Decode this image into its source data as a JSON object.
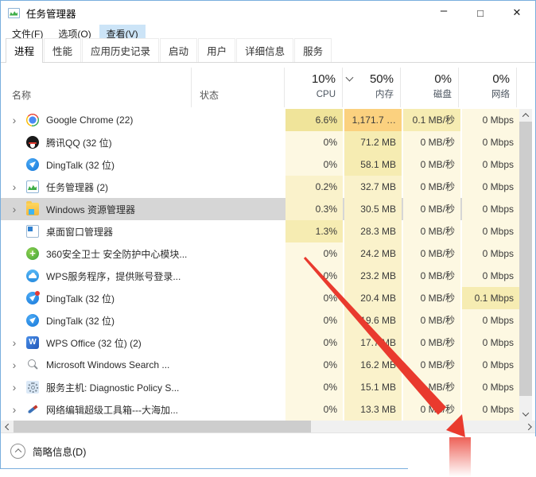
{
  "window": {
    "title": "任务管理器",
    "controls": {
      "minimize": "–",
      "maximize": "□",
      "close": "✕"
    }
  },
  "menu": [
    {
      "label": "文件(F)"
    },
    {
      "label": "选项(O)"
    },
    {
      "label": "查看(V)",
      "highlighted": true
    }
  ],
  "tabs": [
    {
      "label": "进程",
      "active": true
    },
    {
      "label": "性能"
    },
    {
      "label": "应用历史记录"
    },
    {
      "label": "启动"
    },
    {
      "label": "用户"
    },
    {
      "label": "详细信息"
    },
    {
      "label": "服务"
    }
  ],
  "columns": {
    "name": "名称",
    "status": "状态",
    "metrics": [
      {
        "percent": "10%",
        "label": "CPU"
      },
      {
        "percent": "50%",
        "label": "内存",
        "sorted": "desc"
      },
      {
        "percent": "0%",
        "label": "磁盘"
      },
      {
        "percent": "0%",
        "label": "网络"
      }
    ]
  },
  "glyphs": {
    "expand": "›"
  },
  "colors": {
    "accent_border": "#79aede",
    "menu_highlight": "#cce4f7",
    "selected_row": "#d6d6d6",
    "heat": [
      "#fdf8e2",
      "#faf2cb",
      "#f6ecb2",
      "#f0e49a",
      "#fbd17f"
    ],
    "annotation_arrow": "#e93a2e"
  },
  "processes": [
    {
      "name": "Google Chrome (22)",
      "icon": "chrome",
      "expandable": true,
      "selected": false,
      "badge": false,
      "cpu": "6.6%",
      "mem": "1,171.7 …",
      "disk": "0.1 MB/秒",
      "net": "0 Mbps",
      "heat": [
        3,
        4,
        2,
        0
      ]
    },
    {
      "name": "腾讯QQ (32 位)",
      "icon": "qq",
      "expandable": false,
      "selected": false,
      "badge": false,
      "cpu": "0%",
      "mem": "71.2 MB",
      "disk": "0 MB/秒",
      "net": "0 Mbps",
      "heat": [
        0,
        2,
        0,
        0
      ]
    },
    {
      "name": "DingTalk (32 位)",
      "icon": "dingtalk",
      "expandable": false,
      "selected": false,
      "badge": false,
      "cpu": "0%",
      "mem": "58.1 MB",
      "disk": "0 MB/秒",
      "net": "0 Mbps",
      "heat": [
        0,
        2,
        0,
        0
      ]
    },
    {
      "name": "任务管理器 (2)",
      "icon": "taskmgr",
      "expandable": true,
      "selected": false,
      "badge": false,
      "cpu": "0.2%",
      "mem": "32.7 MB",
      "disk": "0 MB/秒",
      "net": "0 Mbps",
      "heat": [
        1,
        1,
        0,
        0
      ]
    },
    {
      "name": "Windows 资源管理器",
      "icon": "explorer",
      "expandable": true,
      "selected": true,
      "badge": false,
      "cpu": "0.3%",
      "mem": "30.5 MB",
      "disk": "0 MB/秒",
      "net": "0 Mbps",
      "heat": [
        1,
        1,
        0,
        0
      ]
    },
    {
      "name": "桌面窗口管理器",
      "icon": "dwm",
      "expandable": false,
      "selected": false,
      "badge": false,
      "cpu": "1.3%",
      "mem": "28.3 MB",
      "disk": "0 MB/秒",
      "net": "0 Mbps",
      "heat": [
        2,
        1,
        0,
        0
      ]
    },
    {
      "name": "360安全卫士 安全防护中心模块...",
      "icon": "safe360",
      "expandable": false,
      "selected": false,
      "badge": false,
      "cpu": "0%",
      "mem": "24.2 MB",
      "disk": "0 MB/秒",
      "net": "0 Mbps",
      "heat": [
        0,
        1,
        0,
        0
      ]
    },
    {
      "name": "WPS服务程序，提供账号登录...",
      "icon": "wpscloud",
      "expandable": false,
      "selected": false,
      "badge": false,
      "cpu": "0%",
      "mem": "23.2 MB",
      "disk": "0 MB/秒",
      "net": "0 Mbps",
      "heat": [
        0,
        1,
        0,
        0
      ]
    },
    {
      "name": "DingTalk (32 位)",
      "icon": "dingtalk",
      "expandable": false,
      "selected": false,
      "badge": true,
      "cpu": "0%",
      "mem": "20.4 MB",
      "disk": "0 MB/秒",
      "net": "0.1 Mbps",
      "heat": [
        0,
        1,
        0,
        2
      ]
    },
    {
      "name": "DingTalk (32 位)",
      "icon": "dingtalk",
      "expandable": false,
      "selected": false,
      "badge": false,
      "cpu": "0%",
      "mem": "19.6 MB",
      "disk": "0 MB/秒",
      "net": "0 Mbps",
      "heat": [
        0,
        1,
        0,
        0
      ]
    },
    {
      "name": "WPS Office (32 位) (2)",
      "icon": "wpsoffice",
      "expandable": true,
      "selected": false,
      "badge": false,
      "cpu": "0%",
      "mem": "17.7 MB",
      "disk": "0 MB/秒",
      "net": "0 Mbps",
      "heat": [
        0,
        1,
        0,
        0
      ]
    },
    {
      "name": "Microsoft Windows Search ...",
      "icon": "search",
      "expandable": true,
      "selected": false,
      "badge": false,
      "cpu": "0%",
      "mem": "16.2 MB",
      "disk": "0 MB/秒",
      "net": "0 Mbps",
      "heat": [
        0,
        1,
        0,
        0
      ]
    },
    {
      "name": "服务主机: Diagnostic Policy S...",
      "icon": "gear",
      "expandable": true,
      "selected": false,
      "badge": false,
      "cpu": "0%",
      "mem": "15.1 MB",
      "disk": "0 MB/秒",
      "net": "0 Mbps",
      "heat": [
        0,
        1,
        0,
        0
      ]
    },
    {
      "name": "网络编辑超级工具箱---大海加...",
      "icon": "pencil",
      "expandable": true,
      "selected": false,
      "badge": false,
      "cpu": "0%",
      "mem": "13.3 MB",
      "disk": "0 MB/秒",
      "net": "0 Mbps",
      "heat": [
        0,
        1,
        0,
        0
      ]
    }
  ],
  "footer": {
    "label": "简略信息(D)"
  }
}
